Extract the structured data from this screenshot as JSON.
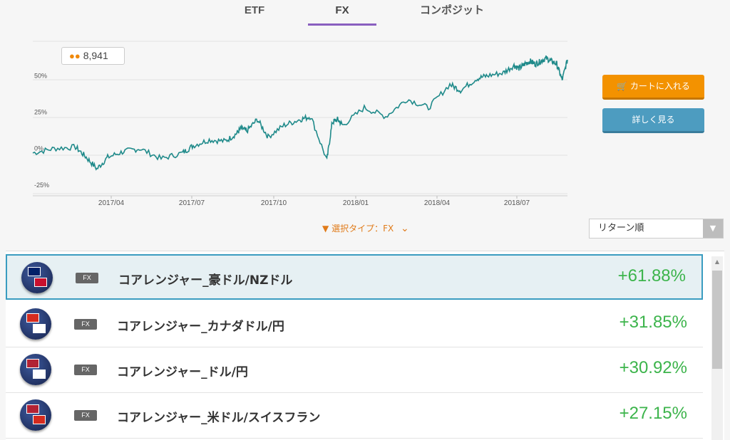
{
  "tabs": [
    {
      "label": "ETF",
      "active": false
    },
    {
      "label": "FX",
      "active": true
    },
    {
      "label": "コンポジット",
      "active": false
    }
  ],
  "user_count": "8,941",
  "buttons": {
    "cart": "カートに入れる",
    "detail": "詳しく見る"
  },
  "filter": {
    "label": "選択タイプ：FX"
  },
  "sort": {
    "selected": "リターン順"
  },
  "chart_data": {
    "type": "line",
    "ytick_labels": [
      "50%",
      "25%",
      "0%",
      "-25%"
    ],
    "yticks": [
      50,
      25,
      0,
      -25
    ],
    "xtick_labels": [
      "2017/04",
      "2017/07",
      "2017/10",
      "2018/01",
      "2018/04",
      "2018/07"
    ],
    "x": [
      0,
      0.04,
      0.08,
      0.1,
      0.12,
      0.14,
      0.17,
      0.2,
      0.24,
      0.28,
      0.3,
      0.33,
      0.36,
      0.38,
      0.39,
      0.4,
      0.42,
      0.44,
      0.47,
      0.5,
      0.52,
      0.55,
      0.56,
      0.57,
      0.58,
      0.62,
      0.66,
      0.7,
      0.74,
      0.78,
      0.8,
      0.83,
      0.85,
      0.88,
      0.9,
      0.91,
      0.92,
      0.93,
      0.94,
      0.95,
      0.96,
      0.97,
      0.98,
      0.99,
      1.0
    ],
    "values": [
      -3,
      0,
      1,
      -6,
      -14,
      -6,
      -2,
      0,
      -7,
      -3,
      2,
      6,
      5,
      10,
      14,
      12,
      20,
      8,
      16,
      20,
      22,
      -8,
      18,
      20,
      16,
      28,
      22,
      34,
      28,
      44,
      40,
      48,
      50,
      52,
      57,
      55,
      58,
      60,
      58,
      60,
      62,
      60,
      58,
      47,
      61
    ]
  },
  "list": [
    {
      "type": "FX",
      "name": "コアレンジャー_豪ドル/NZドル",
      "return": "+61.88%",
      "selected": true,
      "flag_colors": [
        "#012169",
        "#c8102e"
      ]
    },
    {
      "type": "FX",
      "name": "コアレンジャー_カナダドル/円",
      "return": "+31.85%",
      "selected": false,
      "flag_colors": [
        "#d52b1e",
        "#ffffff"
      ]
    },
    {
      "type": "FX",
      "name": "コアレンジャー_ドル/円",
      "return": "+30.92%",
      "selected": false,
      "flag_colors": [
        "#b22234",
        "#ffffff"
      ]
    },
    {
      "type": "FX",
      "name": "コアレンジャー_米ドル/スイスフラン",
      "return": "+27.15%",
      "selected": false,
      "flag_colors": [
        "#b22234",
        "#d52b1e"
      ]
    }
  ],
  "colors": {
    "line": "#1f8a8a",
    "cart": "#f39200",
    "detail": "#4d9cc0",
    "positive": "#3cb44b",
    "tab_active": "#8a5fbf"
  }
}
